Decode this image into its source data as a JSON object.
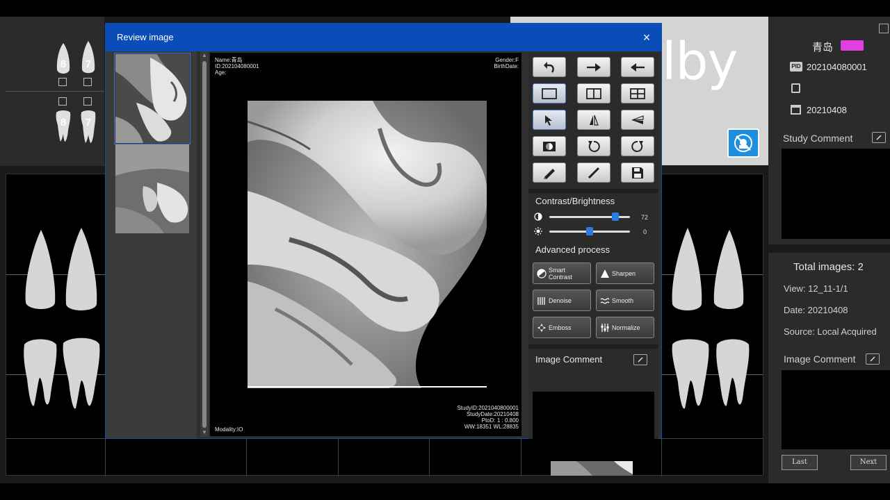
{
  "background": {
    "teeth_top": [
      "8",
      "7",
      "8",
      "7"
    ],
    "logo_partial": "lby",
    "patient": {
      "name": "青岛",
      "pid_tag": "PID",
      "pid": "202104080001",
      "date": "20210408"
    },
    "study_comment_label": "Study Comment",
    "summary": {
      "total": "Total images:  2",
      "view": "View:  12_11-1/1",
      "date": "Date:  20210408",
      "source": "Source:  Local Acquired"
    },
    "image_comment_label": "Image Comment",
    "last_button": "Last",
    "next_button": "Next"
  },
  "dialog": {
    "title": "Review image",
    "close_glyph": "×"
  },
  "viewer": {
    "top_left": [
      "Name:青岛",
      "ID:202104080001",
      "Age:"
    ],
    "top_right": [
      "Gender:F",
      "BirthDate:"
    ],
    "bottom_left": "Modality:IO",
    "bottom_right": [
      "StudyID:2021040800001",
      "StudyDate:20210408",
      "PtoD:  1 : 0.800",
      "WW:18351   WL:28835"
    ]
  },
  "tools": {
    "buttons": [
      {
        "name": "undo-button",
        "icon": "undo-arrow-icon"
      },
      {
        "name": "redo-button",
        "icon": "arrow-right-icon"
      },
      {
        "name": "back-button",
        "icon": "arrow-left-icon"
      },
      {
        "name": "layout-single-button",
        "icon": "single-pane-icon"
      },
      {
        "name": "layout-two-button",
        "icon": "two-pane-icon"
      },
      {
        "name": "layout-four-button",
        "icon": "four-pane-icon"
      },
      {
        "name": "select-button",
        "icon": "cursor-icon"
      },
      {
        "name": "flip-horizontal-button",
        "icon": "flip-horizontal-icon"
      },
      {
        "name": "flip-vertical-button",
        "icon": "flip-vertical-icon"
      },
      {
        "name": "invert-button",
        "icon": "invert-icon"
      },
      {
        "name": "rotate-left-button",
        "icon": "rotate-left-icon"
      },
      {
        "name": "rotate-right-button",
        "icon": "rotate-right-icon"
      },
      {
        "name": "annotate-button",
        "icon": "pencil-icon"
      },
      {
        "name": "measure-button",
        "icon": "ruler-icon"
      },
      {
        "name": "save-button",
        "icon": "floppy-disk-icon"
      }
    ],
    "contrast_title": "Contrast/Brightness",
    "contrast_value": "72",
    "contrast_level": 0.82,
    "brightness_value": "0",
    "brightness_level": 0.5,
    "advanced_title": "Advanced process",
    "process_buttons": {
      "smart_contrast": "Smart Contrast",
      "sharpen": "Sharpen",
      "denoise": "Denoise",
      "smooth": "Smooth",
      "emboss": "Emboss",
      "normalize": "Normalize"
    },
    "image_comment_title": "Image Comment"
  }
}
